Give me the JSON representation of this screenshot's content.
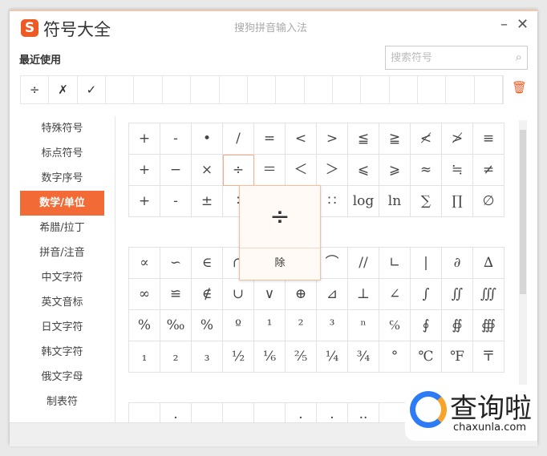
{
  "window": {
    "title": "符号大全",
    "subtitle": "搜狗拼音输入法",
    "minimize": "–",
    "close": "✕"
  },
  "recent": {
    "label": "最近使用",
    "symbols": [
      "÷",
      "✗",
      "✓",
      "",
      "",
      "",
      "",
      "",
      "",
      "",
      "",
      "",
      "",
      "",
      "",
      "",
      ""
    ],
    "clear_icon": "trash-icon"
  },
  "search": {
    "placeholder": "搜索符号"
  },
  "sidebar": {
    "items": [
      "特殊符号",
      "标点符号",
      "数字序号",
      "数学/单位",
      "希腊/拉丁",
      "拼音/注音",
      "中文字符",
      "英文音标",
      "日文字符",
      "韩文字符",
      "俄文字母",
      "制表符"
    ],
    "active": 3
  },
  "grid1": [
    "+",
    "-",
    "•",
    "/",
    "=",
    "<",
    ">",
    "≦",
    "≧",
    "≮",
    "≯",
    "≡",
    "+",
    "−",
    "×",
    "÷",
    "＝",
    "＜",
    "＞",
    "⩽",
    "⩾",
    "≈",
    "≒",
    "≠",
    "+",
    "-",
    "±",
    "∶",
    "",
    "",
    "∷",
    "log",
    "ln",
    "∑",
    "∏",
    "∅"
  ],
  "grid2": [
    "∝",
    "∽",
    "∈",
    "∩",
    "",
    "",
    "⌒",
    "//",
    "∟",
    "|",
    "∂",
    "∆",
    "∞",
    "≌",
    "∉",
    "∪",
    "∨",
    "⊕",
    "⊿",
    "⊥",
    "∠",
    "∫",
    "∬",
    "∭",
    "%",
    "‰",
    "%",
    "º",
    "¹",
    "²",
    "³",
    "ⁿ",
    "℅",
    "∮",
    "∯",
    "∰",
    "₁",
    "₂",
    "₃",
    "½",
    "⅙",
    "⅖",
    "¼",
    "¾",
    "°",
    "℃",
    "℉",
    "〒"
  ],
  "grid3": [
    "",
    "·",
    "",
    "",
    "",
    "·",
    "·",
    "··",
    "",
    "",
    "",
    ""
  ],
  "selected_symbol": "÷",
  "popup": {
    "symbol": "÷",
    "name": "除"
  },
  "accent": "#f26b36",
  "watermark": {
    "text": "查询啦",
    "url": "chaxunla.com"
  }
}
